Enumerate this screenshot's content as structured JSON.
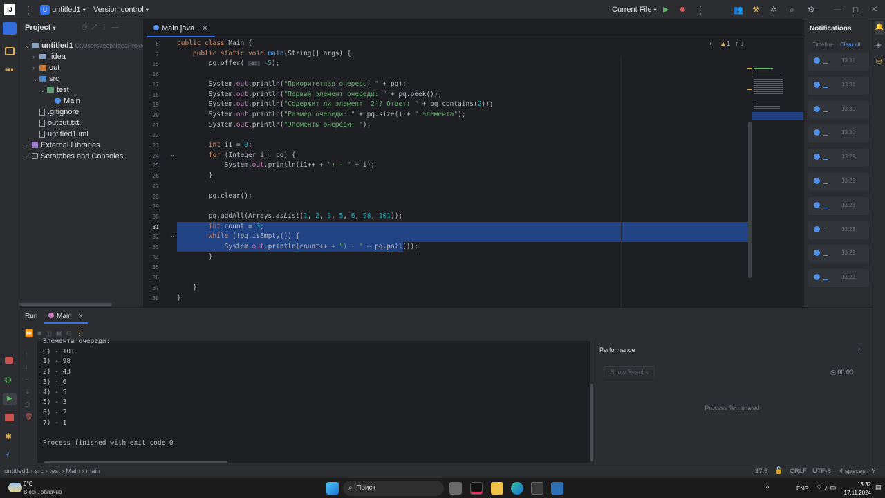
{
  "titlebar": {
    "project_name": "untitled1",
    "project_badge": "U",
    "vcs": "Version control",
    "run_config": "Current File"
  },
  "project_panel": {
    "title": "Project",
    "tree": [
      {
        "label": "untitled1",
        "extra": "C:\\Users\\teeix\\IdeaProjec",
        "indent": 0,
        "icon": "folder",
        "expanded": true
      },
      {
        "label": ".idea",
        "indent": 1,
        "icon": "folder",
        "expanded": false
      },
      {
        "label": "out",
        "indent": 1,
        "icon": "folder-orange",
        "expanded": false
      },
      {
        "label": "src",
        "indent": 1,
        "icon": "folder-blue",
        "expanded": true
      },
      {
        "label": "test",
        "indent": 2,
        "icon": "folder-green",
        "expanded": true
      },
      {
        "label": "Main",
        "indent": 3,
        "icon": "class"
      },
      {
        "label": ".gitignore",
        "indent": 1,
        "icon": "file"
      },
      {
        "label": "output.txt",
        "indent": 1,
        "icon": "file"
      },
      {
        "label": "untitled1.iml",
        "indent": 1,
        "icon": "file"
      },
      {
        "label": "External Libraries",
        "indent": 0,
        "icon": "library",
        "expanded": false
      },
      {
        "label": "Scratches and Consoles",
        "indent": 0,
        "icon": "scratch",
        "expanded": false
      }
    ]
  },
  "editor": {
    "tab": "Main.java",
    "inspections": "1",
    "lines": [
      {
        "n": "6",
        "html": "<span class='kw'>public class</span> Main {"
      },
      {
        "n": "7",
        "html": "    <span class='kw'>public static void</span> <span class='fn'>main</span>(String[] args) {"
      },
      {
        "n": "15",
        "html": "        pq.offer( <span style='background:#393b40;color:#8c8f94;font-size:7px'> e: </span> <span class='num'>-5</span>);"
      },
      {
        "n": "16",
        "html": ""
      },
      {
        "n": "17",
        "html": "        System.<span class='fld'>out</span>.println(<span class='str'>\"Приоритетная очередь: \"</span> + pq);"
      },
      {
        "n": "18",
        "html": "        System.<span class='fld'>out</span>.println(<span class='str'>\"Первый элемент очереди: \"</span> + pq.peek());"
      },
      {
        "n": "19",
        "html": "        System.<span class='fld'>out</span>.println(<span class='str'>\"Содержит ли элемент '2'? Ответ: \"</span> + pq.contains(<span class='num'>2</span>));"
      },
      {
        "n": "20",
        "html": "        System.<span class='fld'>out</span>.println(<span class='str'>\"Размер очереди: \"</span> + pq.size() + <span class='str'>\" элемента\"</span>);"
      },
      {
        "n": "21",
        "html": "        System.<span class='fld'>out</span>.println(<span class='str'>\"Элементы очереди: \"</span>);"
      },
      {
        "n": "22",
        "html": ""
      },
      {
        "n": "23",
        "html": "        <span class='kw'>int</span> i1 = <span class='num'>0</span>;"
      },
      {
        "n": "24",
        "html": "        <span class='kw'>for</span> (Integer i : pq) {"
      },
      {
        "n": "25",
        "html": "            System.<span class='fld'>out</span>.println(i1++ + <span class='str'>\") - \"</span> + i);"
      },
      {
        "n": "26",
        "html": "        }"
      },
      {
        "n": "27",
        "html": ""
      },
      {
        "n": "28",
        "html": "        pq.clear();"
      },
      {
        "n": "29",
        "html": ""
      },
      {
        "n": "30",
        "html": "        pq.addAll(Arrays.<i>asList</i>(<span class='num'>1</span>, <span class='num'>2</span>, <span class='num'>3</span>, <span class='num'>5</span>, <span class='num'>6</span>, <span class='num'>98</span>, <span class='num'>101</span>));"
      },
      {
        "n": "31",
        "html": "        <span class='kw'>int</span> count = <span class='num'>0</span>;"
      },
      {
        "n": "32",
        "html": "        <span class='kw'>while</span> (!pq.isEmpty()) {"
      },
      {
        "n": "33",
        "html": "            System.<span class='fld'>out</span>.println(count++ + <span class='str'>\") - \"</span> + pq.poll());"
      },
      {
        "n": "34",
        "html": "        }"
      },
      {
        "n": "35",
        "html": ""
      },
      {
        "n": "36",
        "html": ""
      },
      {
        "n": "37",
        "html": "    }"
      },
      {
        "n": "38",
        "html": "}"
      }
    ]
  },
  "notifications": {
    "title": "Notifications",
    "timeline": "Timeline",
    "clear_all": "Clear all",
    "items": [
      "13:31",
      "13:31",
      "13:30",
      "13:30",
      "13:29",
      "13:23",
      "13:23",
      "13:23",
      "13:22",
      "13:22"
    ]
  },
  "run": {
    "tab_run": "Run",
    "tab_main": "Main",
    "output": [
      "Элементы очереди:",
      "0) - 101",
      "1) - 98",
      "2) - 43",
      "3) - 6",
      "4) - 5",
      "5) - 3",
      "6) - 2",
      "7) - 1",
      "",
      "Process finished with exit code 0"
    ],
    "performance_title": "Performance",
    "show_results": "Show Results",
    "timer": "00:00",
    "process_terminated": "Process Terminated"
  },
  "status": {
    "breadcrumb": [
      "untitled1",
      "src",
      "test",
      "Main",
      "main"
    ],
    "position": "37:6",
    "line_sep": "CRLF",
    "encoding": "UTF-8",
    "indent": "4 spaces"
  },
  "taskbar": {
    "weather_temp": "6°C",
    "weather_desc": "В осн. облачно",
    "search": "Поиск",
    "lang": "ENG",
    "time": "13:32",
    "date": "17.11.2024"
  }
}
